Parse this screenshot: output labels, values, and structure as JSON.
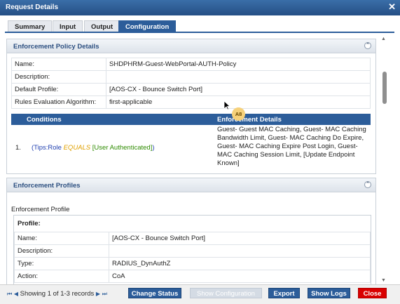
{
  "window": {
    "title": "Request Details",
    "close_glyph": "✕"
  },
  "tabs": [
    "Summary",
    "Input",
    "Output",
    "Configuration"
  ],
  "policy": {
    "title": "Enforcement Policy Details",
    "rows": [
      {
        "label": "Name:",
        "value": "SHDPHRM-Guest-WebPortal-AUTH-Policy"
      },
      {
        "label": "Description:",
        "value": ""
      },
      {
        "label": "Default Profile:",
        "value": "[AOS-CX - Bounce Switch Port]"
      },
      {
        "label": "Rules Evaluation Algorithm:",
        "value": "first-applicable"
      }
    ],
    "conditions_header": "Conditions",
    "enforcement_header": "Enforcement Details",
    "rule": {
      "index": "1.",
      "open": "(",
      "attr": "Tips:Role",
      "op": "EQUALS",
      "val": "[User Authenticated]",
      "close": ")",
      "details": "Guest- Guest MAC Caching, Guest- MAC Caching Bandwidth Limit, Guest- MAC Caching Do Expire, Guest- MAC Caching Expire Post Login, Guest- MAC Caching Session Limit, [Update Endpoint Known]"
    }
  },
  "profiles": {
    "title": "Enforcement Profiles",
    "subtitle": "Enforcement Profile",
    "profile_header": "Profile:",
    "rows": [
      {
        "label": "Name:",
        "value": "[AOS-CX - Bounce Switch Port]"
      },
      {
        "label": "Description:",
        "value": ""
      },
      {
        "label": "Type:",
        "value": "RADIUS_DynAuthZ"
      },
      {
        "label": "Action:",
        "value": "CoA"
      }
    ]
  },
  "footer": {
    "pager_text": "Showing 1 of 1-3 records",
    "buttons": [
      "Change Status",
      "Show Configuration",
      "Export",
      "Show Logs",
      "Close"
    ]
  },
  "overlay_badge": "A8",
  "colors": {
    "primary": "#2c5d9a",
    "danger": "#d90000",
    "attr": "#1f3fb0",
    "op": "#e0a100",
    "val": "#2e8b00"
  }
}
